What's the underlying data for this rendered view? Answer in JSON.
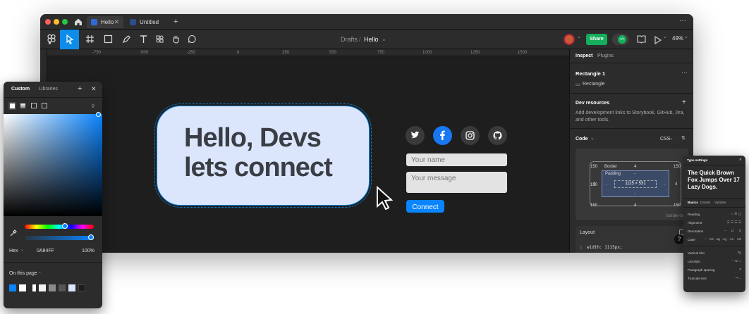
{
  "tabs": [
    {
      "label": "Hello",
      "close": "✕"
    },
    {
      "label": "Untitled"
    }
  ],
  "tab_add": "+",
  "menu_more": "···",
  "breadcrumb": {
    "parent": "Drafts",
    "sep": "/",
    "current": "Hello",
    "chevron": "⌄"
  },
  "toolbar": {
    "share": "Share",
    "zoom": "49%",
    "zoom_chevron": "⌄",
    "dev_mode": "</>",
    "chevron": "⌄"
  },
  "ruler": [
    "-750",
    "-500",
    "-250",
    "0",
    "250",
    "500",
    "750",
    "1000",
    "1250",
    "1500"
  ],
  "canvas": {
    "headline_1": "Hello, Devs",
    "headline_2": "lets connect",
    "name_placeholder": "Your name",
    "message_placeholder": "Your message",
    "connect": "Connect"
  },
  "inspect": {
    "tab_inspect": "Inspect",
    "tab_plugins": "Plugins",
    "layer_name": "Rectangle 1",
    "layer_more": "···",
    "layer_type": "Rectangle",
    "dev_resources": "Dev resources",
    "dev_resources_add": "+",
    "dev_resources_desc": "Add development links to Storybook, GitHub, Jira, and other tools.",
    "code": "Code",
    "code_chevron": "⌄",
    "lang": "CSS",
    "box": {
      "margin_top": "150",
      "margin_right": "150",
      "margin_bottom": "150",
      "margin_left": "150",
      "border_label": "Border",
      "border_top": "4",
      "border_left": "4",
      "border_right": "4",
      "border_bottom": "4",
      "padding_label": "Padding",
      "padding_top": "-",
      "padding_left": "-",
      "padding_right": "-",
      "padding_bottom": "-",
      "size": "1115 × 531",
      "sizing": "border-box"
    },
    "layout": "Layout",
    "code_line_no": "1",
    "code_line": "width: 1115px;",
    "help": "?"
  },
  "picker": {
    "tab_custom": "Custom",
    "tab_libraries": "Libraries",
    "add": "+",
    "close": "✕",
    "format": "Hex",
    "format_chevron": "⌄",
    "hex": "0A84FF",
    "opacity": "100%",
    "on_this_page": "On this page",
    "on_this_page_chevron": "⌄",
    "swatches": [
      "#0a84ff",
      "#ffffff",
      "#2b2b2b",
      "#f2f2f2",
      "#8a8a8a",
      "#555555",
      "#dbe6fd",
      "#1e1e1e"
    ]
  },
  "type_settings": {
    "title": "Type settings",
    "close": "✕",
    "preview": "The Quick Brown Fox Jumps Over 17 Lazy Dogs.",
    "tab_basics": "Basics",
    "tab_details": "Details",
    "tab_variable": "Variable",
    "reading": "Reading",
    "alignment": "Alignment",
    "decoration": "Decoration",
    "decoration_values": [
      "–",
      "U",
      "S"
    ],
    "case": "Case",
    "case_values": [
      "–",
      "AG",
      "ag",
      "Ag",
      "As",
      "AS"
    ],
    "vertical_trim": "Vertical trim",
    "vertical_trim_value": "Tg",
    "list_style": "List style",
    "list_style_values": [
      "–",
      "≔",
      "⋮="
    ],
    "paragraph_spacing": "Paragraph spacing",
    "paragraph_spacing_value": "0",
    "truncate": "Truncate text",
    "truncate_values": [
      "–",
      "+..."
    ]
  },
  "colors": {
    "accent": "#0d8ce9",
    "share": "#14ae5c",
    "card": "#dbe6fd",
    "headline": "#3a3d44",
    "field": "#e3e3e3",
    "button": "#0a84ff"
  }
}
